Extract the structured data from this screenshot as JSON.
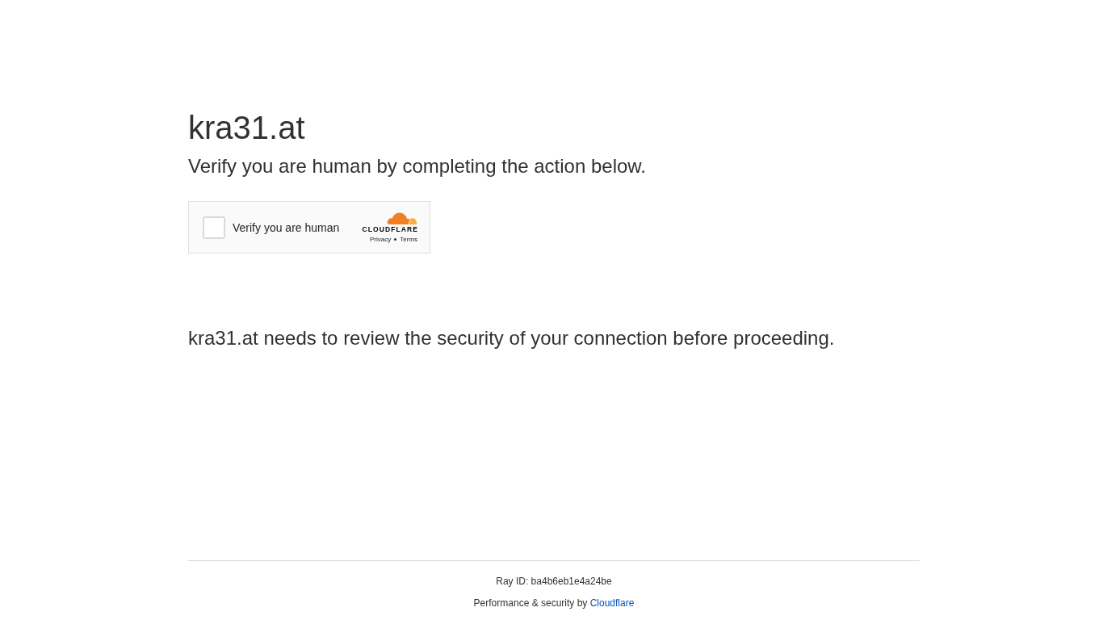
{
  "site": {
    "domain": "kra31.at",
    "heading": "Verify you are human by completing the action below."
  },
  "challenge": {
    "label": "Verify you are human",
    "checked": false,
    "brand": "CLOUDFLARE",
    "links": [
      "Privacy",
      "Terms"
    ]
  },
  "message": "kra31.at needs to review the security of your connection before proceeding.",
  "footer": {
    "ray_id": "Ray ID: ba4b6eb1e4a24be",
    "credit": "Performance & security by",
    "credit_link": "Cloudflare"
  }
}
